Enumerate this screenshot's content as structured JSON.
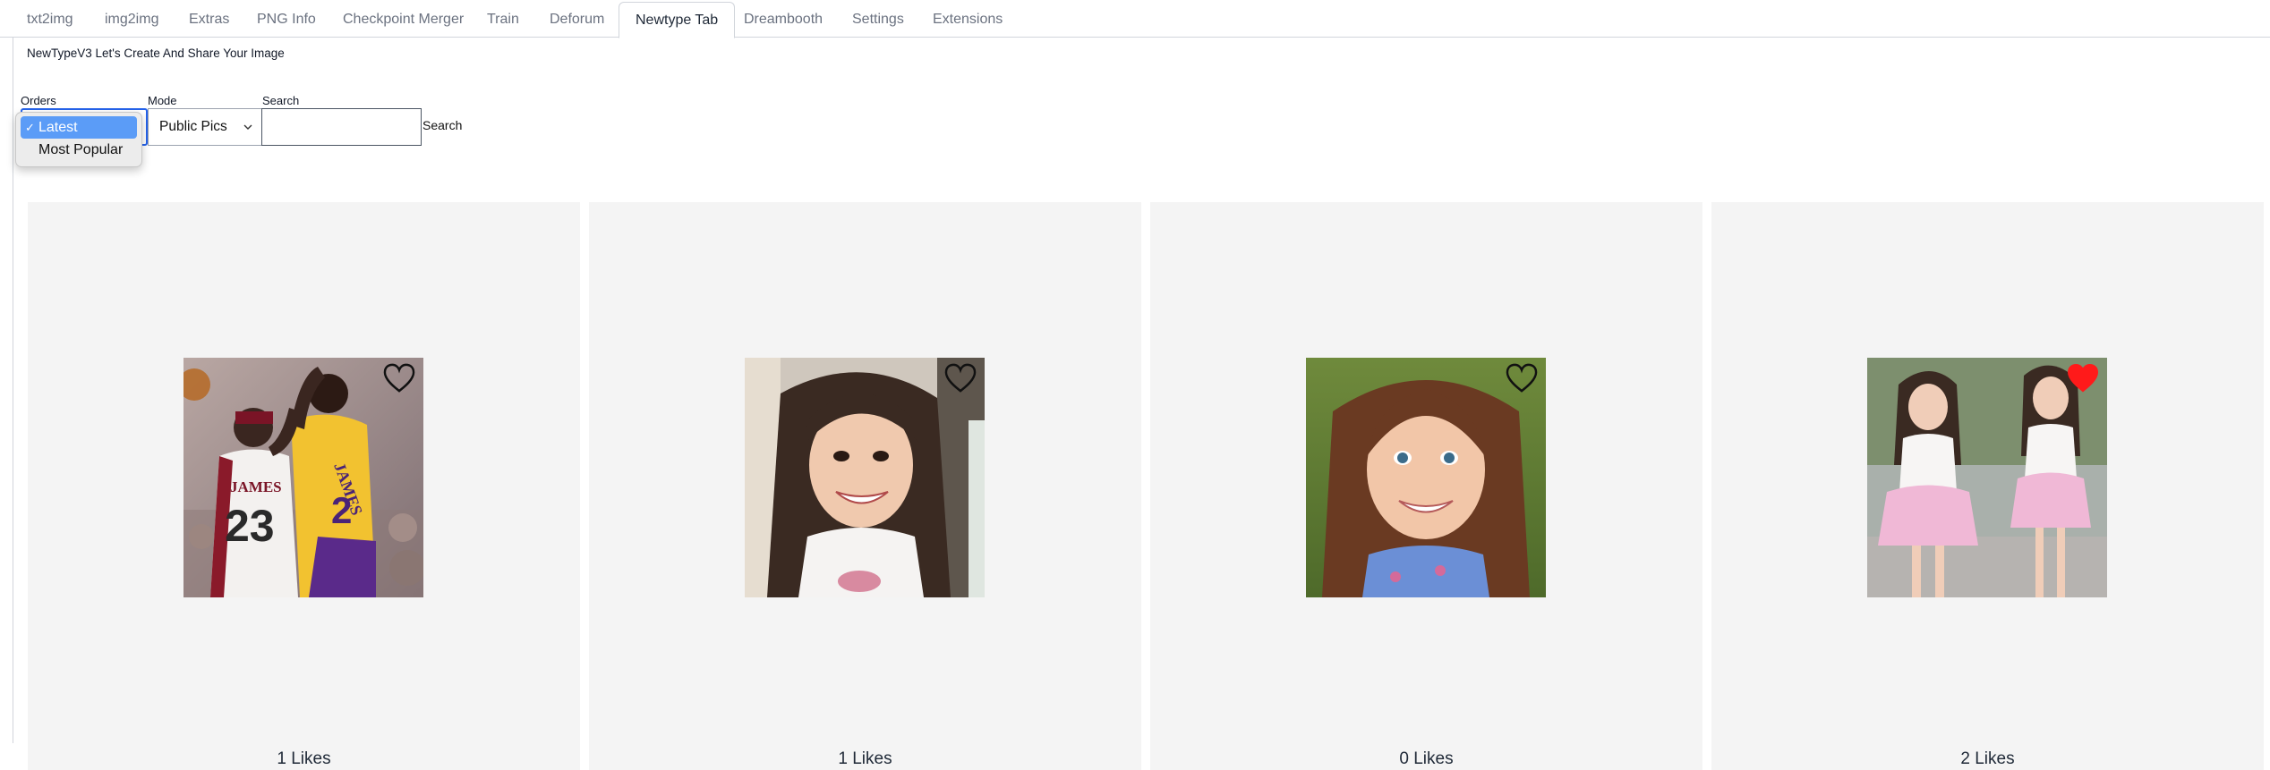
{
  "tabs": [
    {
      "label": "txt2img"
    },
    {
      "label": "img2img"
    },
    {
      "label": "Extras"
    },
    {
      "label": "PNG Info"
    },
    {
      "label": "Checkpoint Merger"
    },
    {
      "label": "Train"
    },
    {
      "label": "Deforum"
    },
    {
      "label": "Newtype Tab",
      "active": true
    },
    {
      "label": "Dreambooth"
    },
    {
      "label": "Settings"
    },
    {
      "label": "Extensions"
    }
  ],
  "headline": "NewTypeV3 Let's Create And Share Your Image",
  "controls": {
    "orders_label": "Orders",
    "mode_label": "Mode",
    "mode_value": "Public Pics",
    "search_label": "Search",
    "search_value": "",
    "search_button": "Search"
  },
  "orders_dropdown": {
    "check": "✓",
    "options": [
      {
        "label": "Latest",
        "selected": true
      },
      {
        "label": "Most Popular",
        "selected": false
      }
    ]
  },
  "cards": [
    {
      "likes": "1 Likes",
      "liked": false,
      "image": "basketball-players-photo"
    },
    {
      "likes": "1 Likes",
      "liked": false,
      "image": "smiling-girl-long-hair-photo"
    },
    {
      "likes": "0 Likes",
      "liked": false,
      "image": "smiling-child-portrait-photo"
    },
    {
      "likes": "2 Likes",
      "liked": true,
      "image": "two-girls-pink-skirts-photo"
    }
  ],
  "colors": {
    "accent": "#2563eb",
    "dropdown_highlight": "#5b9cf7",
    "heart_liked": "#ff1a1a",
    "card_bg": "#f4f4f4"
  }
}
